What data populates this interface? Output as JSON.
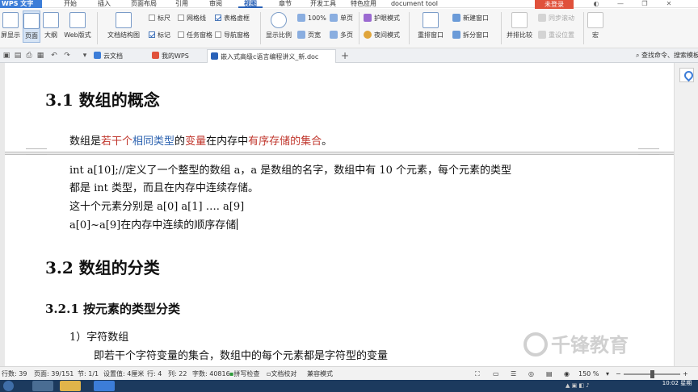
{
  "menubar": {
    "app_name": "WPS 文字",
    "tabs": [
      "开始",
      "插入",
      "页面布局",
      "引用",
      "审阅",
      "视图",
      "章节",
      "开发工具",
      "特色应用",
      "document tool"
    ],
    "active_tab": "视图",
    "login_label": "未登录"
  },
  "ribbon": {
    "views": [
      "屏显示",
      "页面",
      "大纲",
      "Web版式"
    ],
    "doc_map": "文档结构图",
    "checkboxes": {
      "ruler": "标尺",
      "gridlines": "网格线",
      "table_frame": "表格虚框",
      "markup": "标记",
      "task_pane": "任务窗格",
      "nav_pane": "导航窗格"
    },
    "zoom": {
      "display_ratio": "显示比例",
      "percent_100": "100%",
      "page_width": "页宽",
      "single_page": "单页",
      "multi_page": "多页"
    },
    "eye_mode": "护眼模式",
    "night_mode": "夜间模式",
    "arrange_all": "重排窗口",
    "new_window": "新建窗口",
    "split_window": "拆分窗口",
    "side_by_side": "并排比较",
    "sync_scroll": "同步滚动",
    "reset_position": "重设位置",
    "macro": "宏"
  },
  "tabs_row": {
    "tabs": [
      "云文档",
      "我的WPS",
      "嵌入式高级c语言编程讲义_新.doc"
    ],
    "add": "+",
    "search": "查找命令、搜索模板"
  },
  "document": {
    "heading_1": "3.1  数组的概念",
    "line_1": {
      "a": "数组是",
      "b": "若干个",
      "c": "相同类型",
      "d": "的",
      "e": "变量",
      "f": "在内存中",
      "g": "有序存储的集合",
      "h": "。"
    },
    "line_2": "int   a[10];//定义了一个整型的数组 a，a 是数组的名字，数组中有 10 个元素，每个元素的类型",
    "line_3": "都是 int 类型，而且在内存中连续存储。",
    "line_4": "这十个元素分别是 a[0]    a[1]          ….     a[9]",
    "line_5": "a[0]~a[9]在内存中连续的顺序存储",
    "heading_2": "3.2  数组的分类",
    "heading_3": "3.2.1  按元素的类型分类",
    "item_1": "1）字符数组",
    "item_1_desc": "即若干个字符变量的集合，数组中的每个元素都是字符型的变量"
  },
  "watermark": "千锋教育",
  "statusbar": {
    "line": "行数: 39",
    "page": "页面: 39/151",
    "section": "节: 1/1",
    "setting": "设置值: 4厘米",
    "row": "行: 4",
    "col": "列: 22",
    "words": "字数: 40816",
    "spell": "拼写检查",
    "proofread": "文档校对",
    "compat": "兼容模式",
    "zoom": "150 %"
  },
  "taskbar": {
    "time": "10:02",
    "weekday": "星期"
  },
  "colors": {
    "accent": "#3c7dd8",
    "highlight_red": "#c0362c",
    "highlight_blue": "#2d63b0",
    "login": "#e0513b",
    "taskbar": "#1c3a5e"
  }
}
